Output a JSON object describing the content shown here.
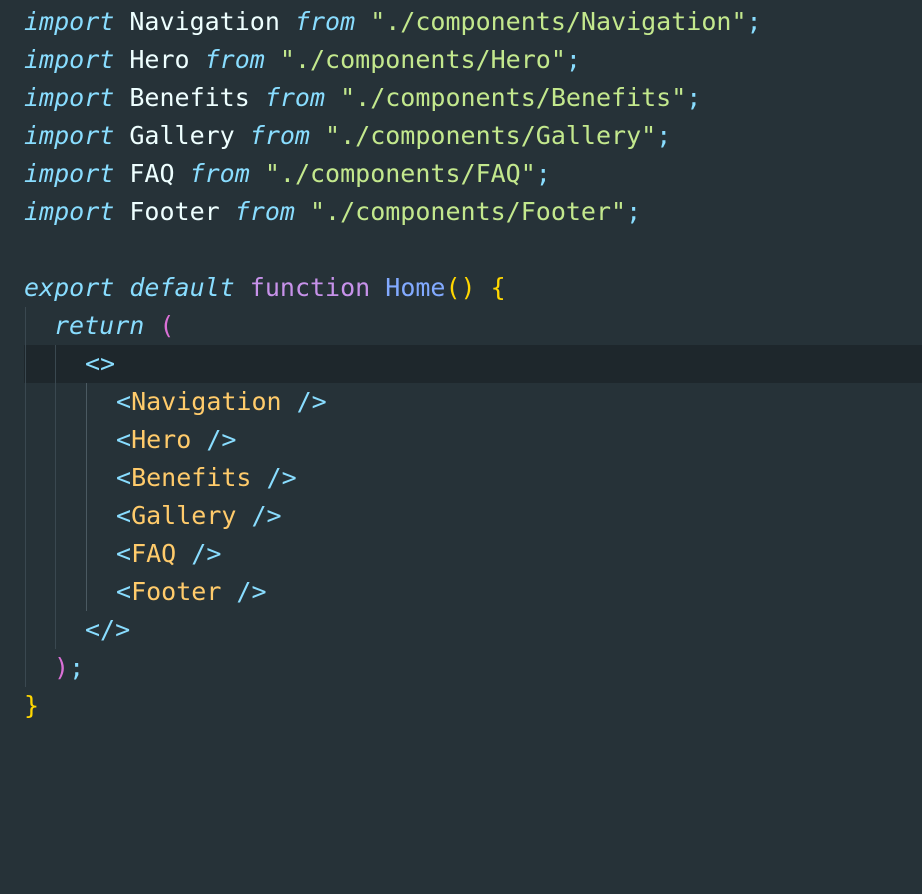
{
  "editor": {
    "lines": [
      {
        "kw": "import",
        "ident": " Navigation ",
        "from": "from",
        "str": " \"./components/Navigation\"",
        "semi": ";"
      },
      {
        "kw": "import",
        "ident": " Hero ",
        "from": "from",
        "str": " \"./components/Hero\"",
        "semi": ";"
      },
      {
        "kw": "import",
        "ident": " Benefits ",
        "from": "from",
        "str": " \"./components/Benefits\"",
        "semi": ";"
      },
      {
        "kw": "import",
        "ident": " Gallery ",
        "from": "from",
        "str": " \"./components/Gallery\"",
        "semi": ";"
      },
      {
        "kw": "import",
        "ident": " FAQ ",
        "from": "from",
        "str": " \"./components/FAQ\"",
        "semi": ";"
      },
      {
        "kw": "import",
        "ident": " Footer ",
        "from": "from",
        "str": " \"./components/Footer\"",
        "semi": ";"
      }
    ],
    "export_kw": "export",
    "default_kw": "default",
    "function_kw": "function",
    "function_name": "Home",
    "parens": "()",
    "open_brace": "{",
    "return_kw": "return",
    "open_paren": "(",
    "fragment_open": "<>",
    "components": [
      {
        "open": "<",
        "name": "Navigation",
        "close": " />"
      },
      {
        "open": "<",
        "name": "Hero",
        "close": " />"
      },
      {
        "open": "<",
        "name": "Benefits",
        "close": " />"
      },
      {
        "open": "<",
        "name": "Gallery",
        "close": " />"
      },
      {
        "open": "<",
        "name": "FAQ",
        "close": " />"
      },
      {
        "open": "<",
        "name": "Footer",
        "close": " />"
      }
    ],
    "fragment_close": "</>",
    "close_paren": ")",
    "semi": ";",
    "close_brace": "}"
  }
}
